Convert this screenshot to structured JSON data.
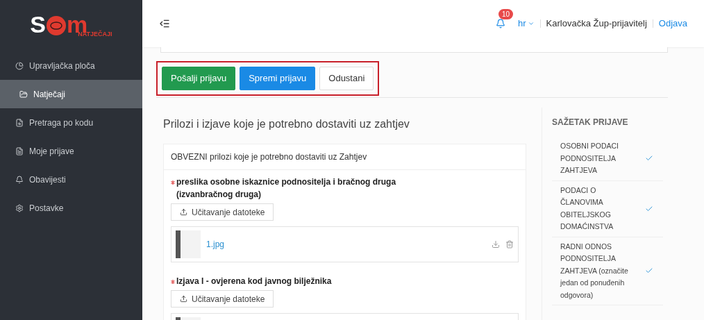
{
  "logo": {
    "letter_left": "S",
    "letter_right": "m",
    "tagline": "NATJEČAJI"
  },
  "sidebar": {
    "items": [
      {
        "label": "Upravljačka ploča",
        "selected": false
      },
      {
        "label": "Natječaji",
        "selected": true
      },
      {
        "label": "Pretraga po kodu",
        "selected": false
      },
      {
        "label": "Moje prijave",
        "selected": false
      },
      {
        "label": "Obavijesti",
        "selected": false
      },
      {
        "label": "Postavke",
        "selected": false
      }
    ]
  },
  "header": {
    "notification_count": "10",
    "language": "hr",
    "user": "Karlovačka Žup-prijavitelj",
    "logout": "Odjava"
  },
  "actions": [
    {
      "label": "Pošalji prijavu",
      "kind": "success"
    },
    {
      "label": "Spremi prijavu",
      "kind": "primary"
    },
    {
      "label": "Odustani",
      "kind": "default"
    }
  ],
  "section_title": "Prilozi i izjave koje je potrebno dostaviti uz zahtjev",
  "attachments_card": {
    "title": "OBVEZNI prilozi koje je potrebno dostaviti uz Zahtjev",
    "items": [
      {
        "required": true,
        "label": "preslika osobne iskaznice podnositelja i bračnog druga (izvanbračnog druga)",
        "upload": "Učitavanje datoteke",
        "file_name": "1.jpg"
      },
      {
        "required": true,
        "label": "Izjava I - ovjerena kod javnog bilježnika",
        "upload": "Učitavanje datoteke"
      }
    ]
  },
  "summary": {
    "title": "SAŽETAK PRIJAVE",
    "items": [
      {
        "label": "OSOBNI PODACI PODNOSITELJA ZAHTJEVA",
        "checked": true
      },
      {
        "label": "PODACI O ČLANOVIMA OBITELJSKOG DOMAĆINSTVA",
        "checked": true
      },
      {
        "label": "RADNI ODNOS PODNOSITELJA ZAHTJEVA (označite jedan od ponuđenih odgovora)",
        "checked": true
      }
    ]
  }
}
